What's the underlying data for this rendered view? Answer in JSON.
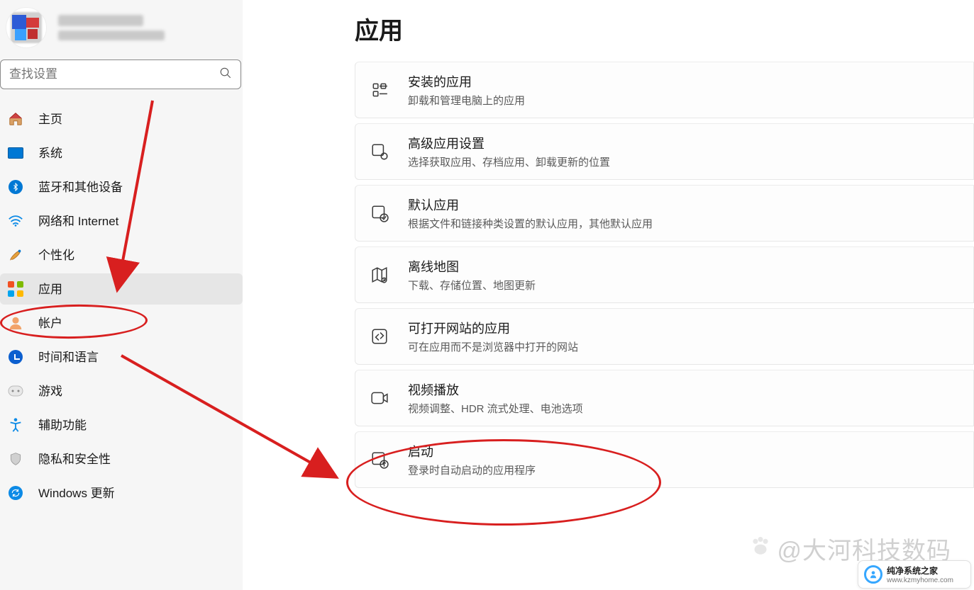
{
  "search": {
    "placeholder": "查找设置"
  },
  "sidebar": {
    "items": [
      {
        "label": "主页",
        "icon": "home-icon"
      },
      {
        "label": "系统",
        "icon": "system-icon"
      },
      {
        "label": "蓝牙和其他设备",
        "icon": "bluetooth-icon"
      },
      {
        "label": "网络和 Internet",
        "icon": "network-icon"
      },
      {
        "label": "个性化",
        "icon": "personalization-icon"
      },
      {
        "label": "应用",
        "icon": "apps-icon",
        "selected": true
      },
      {
        "label": "帐户",
        "icon": "accounts-icon"
      },
      {
        "label": "时间和语言",
        "icon": "time-language-icon"
      },
      {
        "label": "游戏",
        "icon": "gaming-icon"
      },
      {
        "label": "辅助功能",
        "icon": "accessibility-icon"
      },
      {
        "label": "隐私和安全性",
        "icon": "privacy-icon"
      },
      {
        "label": "Windows 更新",
        "icon": "windows-update-icon"
      }
    ]
  },
  "page": {
    "title": "应用"
  },
  "cards": [
    {
      "title": "安装的应用",
      "desc": "卸载和管理电脑上的应用",
      "icon": "installed-apps-icon"
    },
    {
      "title": "高级应用设置",
      "desc": "选择获取应用、存档应用、卸载更新的位置",
      "icon": "advanced-app-settings-icon"
    },
    {
      "title": "默认应用",
      "desc": "根据文件和链接种类设置的默认应用，其他默认应用",
      "icon": "default-apps-icon"
    },
    {
      "title": "离线地图",
      "desc": "下载、存储位置、地图更新",
      "icon": "offline-maps-icon"
    },
    {
      "title": "可打开网站的应用",
      "desc": "可在应用而不是浏览器中打开的网站",
      "icon": "apps-for-websites-icon"
    },
    {
      "title": "视频播放",
      "desc": "视频调整、HDR 流式处理、电池选项",
      "icon": "video-playback-icon"
    },
    {
      "title": "启动",
      "desc": "登录时自动启动的应用程序",
      "icon": "startup-icon"
    }
  ],
  "watermark": {
    "author": "@大河科技数码",
    "brand": "纯净系统之家",
    "brand_url": "www.kzmyhome.com"
  },
  "colors": {
    "accent": "#0078d4",
    "annotation": "#d81f1f"
  }
}
